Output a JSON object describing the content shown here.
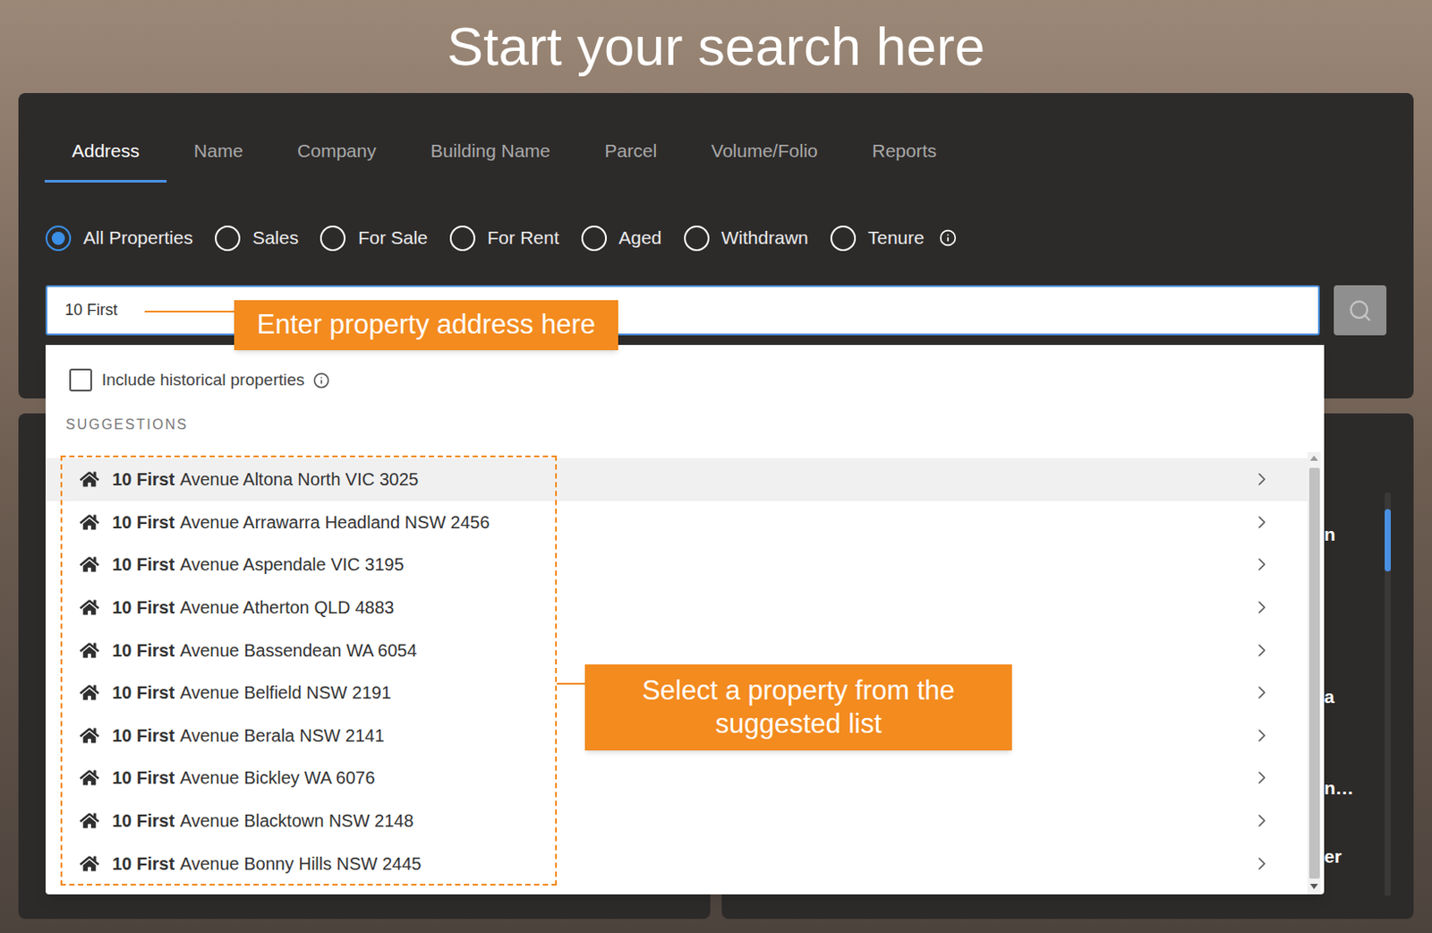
{
  "page": {
    "title": "Start your search here"
  },
  "tabs": [
    {
      "label": "Address",
      "selected": true
    },
    {
      "label": "Name",
      "selected": false
    },
    {
      "label": "Company",
      "selected": false
    },
    {
      "label": "Building Name",
      "selected": false
    },
    {
      "label": "Parcel",
      "selected": false
    },
    {
      "label": "Volume/Folio",
      "selected": false
    },
    {
      "label": "Reports",
      "selected": false
    }
  ],
  "filters": [
    {
      "label": "All Properties",
      "selected": true
    },
    {
      "label": "Sales",
      "selected": false
    },
    {
      "label": "For Sale",
      "selected": false
    },
    {
      "label": "For Rent",
      "selected": false
    },
    {
      "label": "Aged",
      "selected": false
    },
    {
      "label": "Withdrawn",
      "selected": false
    },
    {
      "label": "Tenure",
      "selected": false
    }
  ],
  "search": {
    "value": "10 First"
  },
  "dropdown": {
    "include_historical": {
      "label": "Include historical properties",
      "checked": false
    },
    "section_label": "SUGGESTIONS",
    "suggestions": [
      {
        "match": "10 First",
        "rest": "Avenue Altona North VIC 3025",
        "highlighted": true
      },
      {
        "match": "10 First",
        "rest": "Avenue Arrawarra Headland NSW 2456",
        "highlighted": false
      },
      {
        "match": "10 First",
        "rest": "Avenue Aspendale VIC 3195",
        "highlighted": false
      },
      {
        "match": "10 First",
        "rest": "Avenue Atherton QLD 4883",
        "highlighted": false
      },
      {
        "match": "10 First",
        "rest": "Avenue Bassendean WA 6054",
        "highlighted": false
      },
      {
        "match": "10 First",
        "rest": "Avenue Belfield NSW 2191",
        "highlighted": false
      },
      {
        "match": "10 First",
        "rest": "Avenue Berala NSW 2141",
        "highlighted": false
      },
      {
        "match": "10 First",
        "rest": "Avenue Bickley WA 6076",
        "highlighted": false
      },
      {
        "match": "10 First",
        "rest": "Avenue Blacktown NSW 2148",
        "highlighted": false
      },
      {
        "match": "10 First",
        "rest": "Avenue Bonny Hills NSW 2445",
        "highlighted": false
      }
    ]
  },
  "annotations": [
    {
      "text": "Enter property address here"
    },
    {
      "text": "Select a property from the suggested list"
    }
  ],
  "background_fragments": [
    "n",
    "a",
    "n…",
    "er"
  ]
}
